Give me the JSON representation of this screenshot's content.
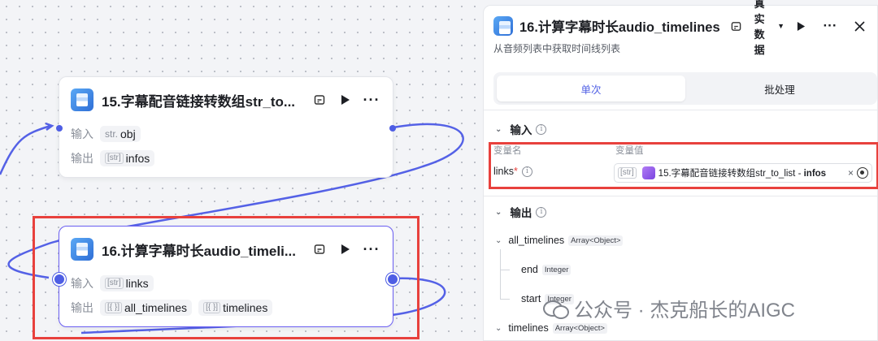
{
  "nodes": [
    {
      "title": "15.字幕配音链接转数组str_to...",
      "input": {
        "label": "输入",
        "tag": "str.",
        "name": "obj"
      },
      "output": {
        "label": "输出",
        "items": [
          {
            "tag": "[str]",
            "name": "infos"
          }
        ]
      }
    },
    {
      "title": "16.计算字幕时长audio_timeli...",
      "input": {
        "label": "输入",
        "tag": "[str]",
        "name": "links"
      },
      "output": {
        "label": "输出",
        "items": [
          {
            "tag": "[{ }]",
            "name": "all_timelines"
          },
          {
            "tag": "[{ }]",
            "name": "timelines"
          }
        ]
      }
    }
  ],
  "panel": {
    "title": "16.计算字幕时长audio_timelines",
    "mode": "真实数据",
    "description": "从音频列表中获取时间线列表",
    "tabs": [
      "单次",
      "批处理"
    ],
    "active_tab": "单次",
    "input_section": {
      "title": "输入",
      "col_name": "变量名",
      "col_value": "变量值",
      "var_name": "links",
      "required_mark": "*",
      "value_tag": "[str]",
      "value_ref": "15.字幕配音链接转数组str_to_list - ",
      "value_field": "infos"
    },
    "output_section": {
      "title": "输出",
      "items": [
        {
          "name": "all_timelines",
          "type": "Array<Object>"
        },
        {
          "name": "end",
          "type": "Integer"
        },
        {
          "name": "start",
          "type": "Integer"
        },
        {
          "name": "timelines",
          "type": "Array<Object>"
        }
      ]
    }
  },
  "watermark": "公众号 · 杰克船长的AIGC",
  "colors": {
    "accent": "#4e5ee4",
    "highlight": "#e8413d",
    "ref_icon": "#9b5cf0"
  }
}
